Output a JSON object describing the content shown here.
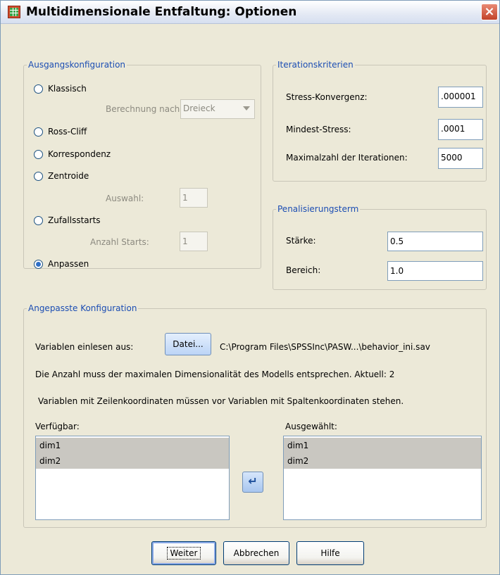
{
  "window": {
    "title": "Multidimensionale Entfaltung: Optionen",
    "close_label": "×"
  },
  "ausgang": {
    "legend": "Ausgangskonfiguration",
    "selected": "Anpassen",
    "klassisch": "Klassisch",
    "berechnung_label": "Berechnung nach",
    "berechnung_value": "Dreieck",
    "ross_cliff": "Ross-Cliff",
    "korrespondenz": "Korrespondenz",
    "zentroide": "Zentroide",
    "auswahl_label": "Auswahl:",
    "auswahl_value": "1",
    "zufallsstarts": "Zufallsstarts",
    "anzahl_label": "Anzahl Starts:",
    "anzahl_value": "1",
    "anpassen": "Anpassen"
  },
  "iteration": {
    "legend": "Iterationskriterien",
    "stress_label": "Stress-Konvergenz:",
    "stress_value": ".000001",
    "mindest_label": "Mindest-Stress:",
    "mindest_value": ".0001",
    "max_label": "Maximalzahl der Iterationen:",
    "max_value": "5000"
  },
  "penal": {
    "legend": "Penalisierungsterm",
    "staerke_label": "Stärke:",
    "staerke_value": "0.5",
    "bereich_label": "Bereich:",
    "bereich_value": "1.0"
  },
  "angepasst": {
    "legend": "Angepasste Konfiguration",
    "read_label": "Variablen einlesen aus:",
    "datei_button": "Datei...",
    "file_path": "C:\\Program Files\\SPSSInc\\PASW...\\behavior_ini.sav",
    "info1": "Die Anzahl muss der maximalen Dimensionalität des Modells entsprechen. Aktuell: 2",
    "info2": "Variablen mit Zeilenkoordinaten müssen vor Variablen mit Spaltenkoordinaten stehen.",
    "verfuegbar_label": "Verfügbar:",
    "verfuegbar_items": [
      "dim1",
      "dim2"
    ],
    "ausgewaehlt_label": "Ausgewählt:",
    "ausgewaehlt_items": [
      "dim1",
      "dim2"
    ],
    "move_icon": "arrow-curved-left-icon"
  },
  "buttons": {
    "weiter": "Weiter",
    "abbrechen": "Abbrechen",
    "hilfe": "Hilfe"
  }
}
